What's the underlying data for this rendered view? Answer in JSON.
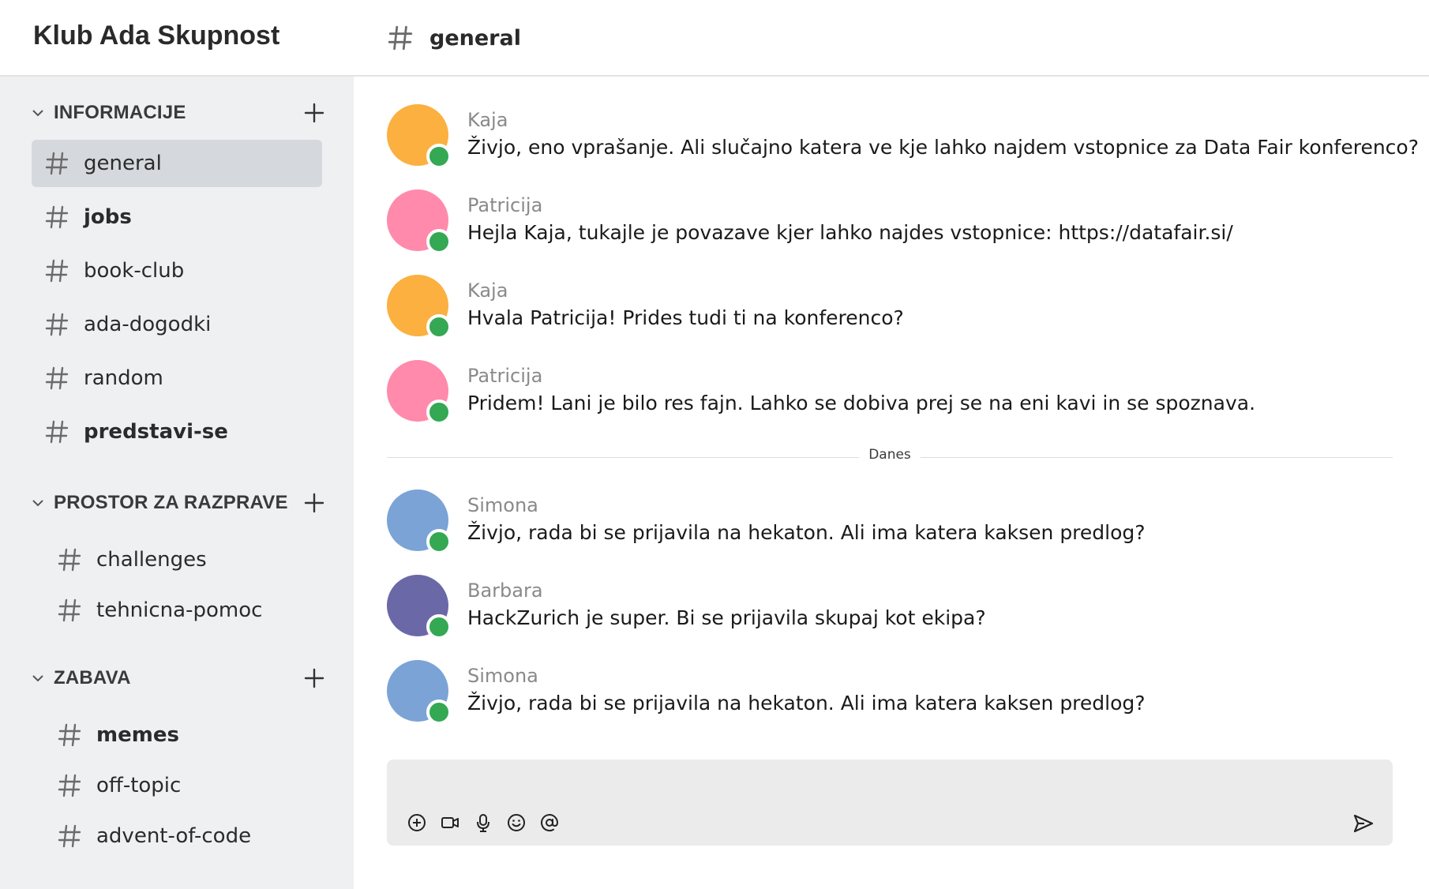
{
  "app": {
    "title": "Klub Ada Skupnost"
  },
  "header": {
    "channel_title": "general",
    "channel_icon": "hash-icon"
  },
  "sidebar": {
    "sections": [
      {
        "title": "INFORMACIJE",
        "channels": [
          {
            "name": "general",
            "active": true,
            "unread": false
          },
          {
            "name": "jobs",
            "active": false,
            "unread": true
          },
          {
            "name": "book-club",
            "active": false,
            "unread": false
          },
          {
            "name": "ada-dogodki",
            "active": false,
            "unread": false
          },
          {
            "name": "random",
            "active": false,
            "unread": false
          },
          {
            "name": "predstavi-se",
            "active": false,
            "unread": true
          }
        ]
      },
      {
        "title": "PROSTOR ZA RAZPRAVE",
        "channels": [
          {
            "name": "challenges",
            "active": false,
            "unread": false
          },
          {
            "name": "tehnicna-pomoc",
            "active": false,
            "unread": false
          }
        ]
      },
      {
        "title": "ZABAVA",
        "channels": [
          {
            "name": "memes",
            "active": false,
            "unread": true
          },
          {
            "name": "off-topic",
            "active": false,
            "unread": false
          },
          {
            "name": "advent-of-code",
            "active": false,
            "unread": false
          }
        ]
      }
    ]
  },
  "messages": [
    {
      "author": "Kaja",
      "text": "Živjo, eno vprašanje. Ali slučajno katera ve kje lahko najdem vstopnice za Data Fair konferenco?",
      "avatar_color": "#fbb040",
      "online": true
    },
    {
      "author": "Patricija",
      "text": "Hejla Kaja, tukajle je povazave kjer lahko najdes vstopnice: https://datafair.si/",
      "avatar_color": "#ff8aab",
      "online": true
    },
    {
      "author": "Kaja",
      "text": "Hvala Patricija! Prides tudi ti na konferenco?",
      "avatar_color": "#fbb040",
      "online": true
    },
    {
      "author": "Patricija",
      "text": "Pridem! Lani je bilo res fajn. Lahko se dobiva prej se na eni kavi in se spoznava.",
      "avatar_color": "#ff8aab",
      "online": true
    }
  ],
  "divider": {
    "label": "Danes"
  },
  "messages_today": [
    {
      "author": "Simona",
      "text": "Živjo, rada bi se prijavila na hekaton. Ali ima katera kaksen predlog?",
      "avatar_color": "#7ba3d6",
      "online": true
    },
    {
      "author": "Barbara",
      "text": "HackZurich je super. Bi se prijavila skupaj kot ekipa?",
      "avatar_color": "#6b68a8",
      "online": true
    },
    {
      "author": "Simona",
      "text": "Živjo, rada bi se prijavila na hekaton. Ali ima katera kaksen predlog?",
      "avatar_color": "#7ba3d6",
      "online": true
    }
  ],
  "composer": {
    "value": "",
    "placeholder": "",
    "tools": [
      "add-circle-icon",
      "video-icon",
      "microphone-icon",
      "emoji-icon",
      "mention-icon"
    ],
    "send_icon": "send-icon"
  },
  "colors": {
    "sidebar_bg": "#eef0f2",
    "active_channel_bg": "#d5d8dc",
    "online_status": "#34a853",
    "composer_bg": "#ebebeb"
  }
}
